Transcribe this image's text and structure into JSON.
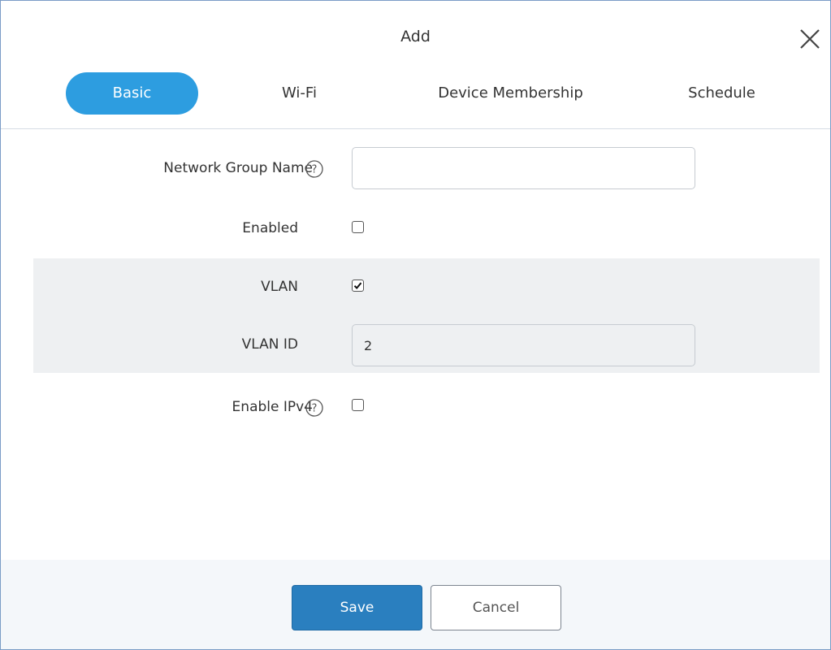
{
  "dialog": {
    "title": "Add"
  },
  "tabs": [
    {
      "label": "Basic",
      "active": true
    },
    {
      "label": "Wi-Fi",
      "active": false
    },
    {
      "label": "Device Membership",
      "active": false
    },
    {
      "label": "Schedule",
      "active": false
    }
  ],
  "form": {
    "network_group_name": {
      "label": "Network Group Name",
      "value": ""
    },
    "enabled": {
      "label": "Enabled",
      "checked": false
    },
    "vlan": {
      "label": "VLAN",
      "checked": true
    },
    "vlan_id": {
      "label": "VLAN ID",
      "value": "2"
    },
    "enable_ipv4": {
      "label": "Enable IPv4",
      "checked": false
    }
  },
  "footer": {
    "save_label": "Save",
    "cancel_label": "Cancel"
  },
  "colors": {
    "accent": "#2d9de0",
    "primary_button": "#2a7fbf",
    "shaded_row": "#eef0f2"
  },
  "icons": {
    "close": "close-icon",
    "help": "help-icon",
    "check": "checkmark-icon"
  }
}
